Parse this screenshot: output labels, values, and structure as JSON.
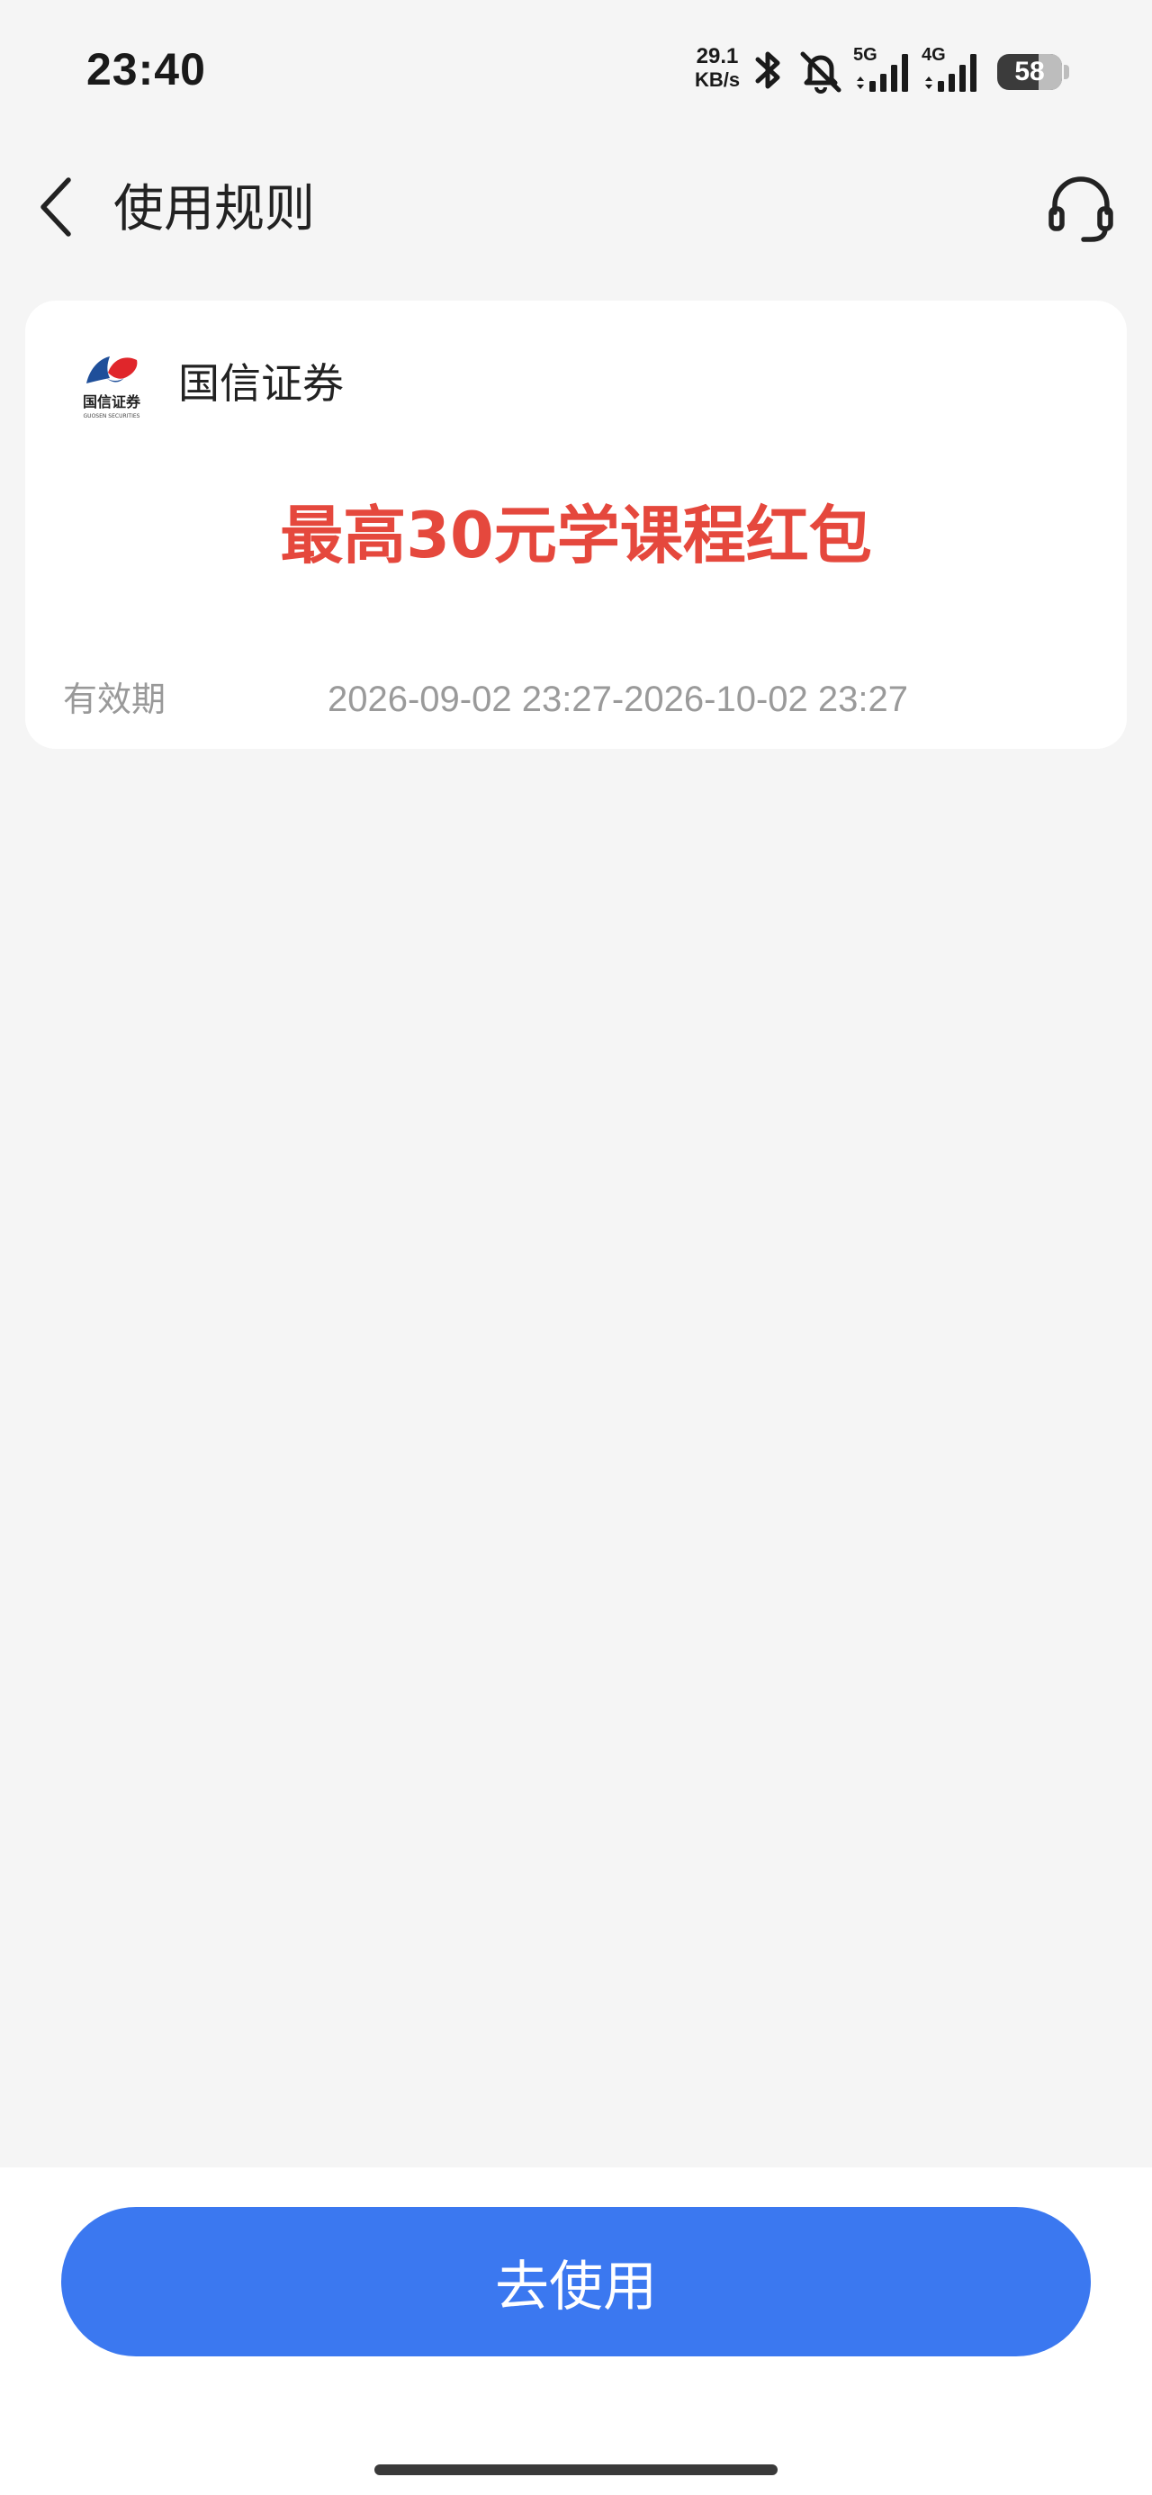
{
  "status_bar": {
    "time": "23:40",
    "net_speed_value": "29.1",
    "net_speed_unit": "KB/s",
    "signal1_label": "5G",
    "signal2_label": "4G",
    "battery_level": "58",
    "icons": [
      "bluetooth-icon",
      "bell-muted-icon",
      "signal-5g-icon",
      "signal-4g-icon",
      "battery-icon"
    ]
  },
  "header": {
    "title": "使用规则",
    "back_icon": "chevron-left-icon",
    "support_icon": "headset-icon"
  },
  "coupon": {
    "brand_name": "国信证券",
    "logo_text": "国信证券",
    "logo_subtext": "GUOSEN SECURITIES",
    "title": "最高30元学课程红包",
    "validity_label": "有效期",
    "validity_value": "2026-09-02 23:27-2026-10-02 23:27"
  },
  "footer": {
    "use_button_label": "去使用"
  },
  "colors": {
    "accent": "#3b78f0",
    "coupon_red": "#e5483d",
    "background": "#f5f5f5"
  }
}
